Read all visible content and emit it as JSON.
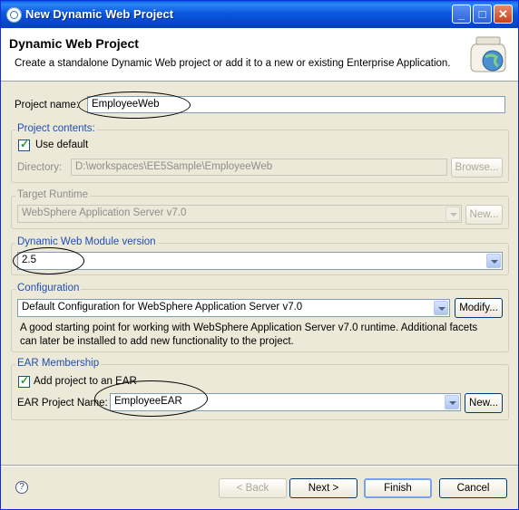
{
  "window": {
    "title": "New Dynamic Web Project",
    "minimize_glyph": "_",
    "maximize_glyph": "□",
    "close_glyph": "✕"
  },
  "header": {
    "title": "Dynamic Web Project",
    "description": "Create a standalone Dynamic Web project or add it to a new or existing Enterprise Application."
  },
  "project_name": {
    "label": "Project name:",
    "value": "EmployeeWeb"
  },
  "project_contents": {
    "legend": "Project contents:",
    "use_default_label": "Use default",
    "use_default_checked": true,
    "directory_label": "Directory:",
    "directory_value": "D:\\workspaces\\EE5Sample\\EmployeeWeb",
    "browse_label": "Browse..."
  },
  "target_runtime": {
    "legend": "Target Runtime",
    "selected": "WebSphere Application Server v7.0",
    "new_label": "New..."
  },
  "module_version": {
    "legend": "Dynamic Web Module version",
    "selected": "2.5"
  },
  "configuration": {
    "legend": "Configuration",
    "selected": "Default Configuration for WebSphere Application Server v7.0",
    "modify_label": "Modify...",
    "description_line1": "A good starting point for working with WebSphere Application Server v7.0 runtime. Additional facets",
    "description_line2": "can later be installed to add new functionality to the project."
  },
  "ear_membership": {
    "legend": "EAR Membership",
    "add_label": "Add project to an EAR",
    "add_checked": true,
    "ear_name_label": "EAR Project Name:",
    "ear_name_value": "EmployeeEAR",
    "new_label": "New..."
  },
  "footer": {
    "help_glyph": "?",
    "back_label": "< Back",
    "next_label": "Next >",
    "finish_label": "Finish",
    "cancel_label": "Cancel"
  },
  "colors": {
    "title_bar": "#0a58e0",
    "group_legend": "#1f4fb0",
    "dialog_background": "#ece9d8"
  }
}
